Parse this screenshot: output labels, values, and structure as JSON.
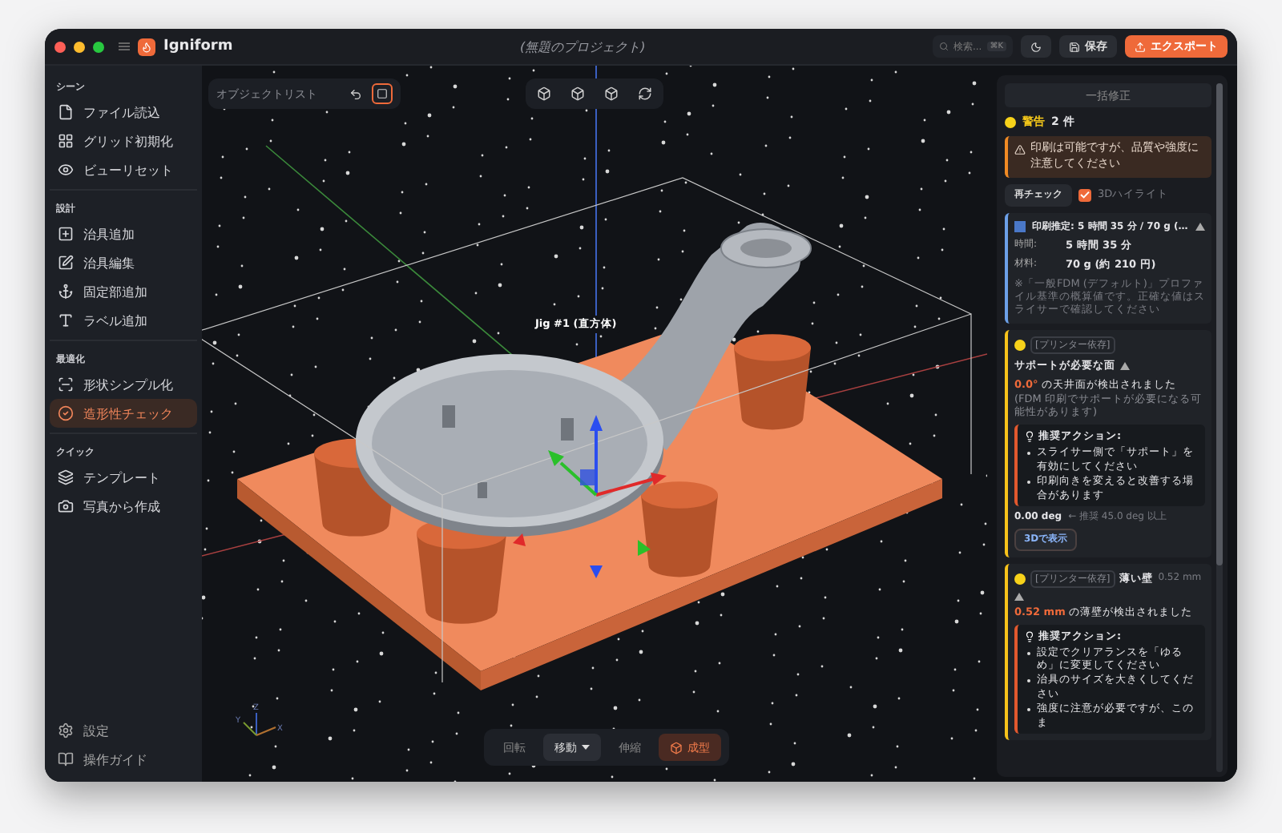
{
  "window": {
    "title": "Igniform",
    "project": "(無題のプロジェクト)"
  },
  "header": {
    "search_placeholder": "検索...",
    "search_shortcut": "⌘K",
    "save": "保存",
    "export": "エクスポート"
  },
  "sidebar": {
    "sections": [
      {
        "title": "シーン",
        "items": [
          {
            "label": "ファイル読込",
            "selected": false
          },
          {
            "label": "グリッド初期化",
            "selected": false
          },
          {
            "label": "ビューリセット",
            "selected": false
          }
        ]
      },
      {
        "title": "設計",
        "items": [
          {
            "label": "治具追加",
            "selected": false
          },
          {
            "label": "治具編集",
            "selected": false
          },
          {
            "label": "固定部追加",
            "selected": false
          },
          {
            "label": "ラベル追加",
            "selected": false
          }
        ]
      },
      {
        "title": "最適化",
        "items": [
          {
            "label": "形状シンプル化",
            "selected": false
          },
          {
            "label": "造形性チェック",
            "selected": true
          }
        ]
      },
      {
        "title": "クイック",
        "items": [
          {
            "label": "テンプレート",
            "selected": false
          },
          {
            "label": "写真から作成",
            "selected": false
          }
        ]
      }
    ],
    "footer": [
      {
        "label": "設定"
      },
      {
        "label": "操作ガイド"
      }
    ]
  },
  "object_list": {
    "title": "オブジェクトリスト",
    "box_mode": true
  },
  "viewport": {
    "object_label": "Jig #1 (直方体)",
    "axis_labels": [
      "X",
      "Y",
      "Z"
    ]
  },
  "mode_bar": [
    {
      "label": "回転",
      "kind": "mode",
      "selected": false
    },
    {
      "label": "移動",
      "kind": "dropdown",
      "selected": true
    },
    {
      "label": "伸縮",
      "kind": "mode",
      "selected": false
    },
    {
      "label": "成型",
      "kind": "action"
    }
  ],
  "check_panel": {
    "fix_all": "一括修正",
    "summary_label": "警告",
    "summary_count": "2 件",
    "alert": "印刷は可能ですが、品質や強度に注意してください",
    "recheck": "再チェック",
    "highlight": {
      "label": "3Dハイライト",
      "checked": true
    },
    "estimate": {
      "title": "印刷推定: 5 時間 35 分 / 70 g (…",
      "expanded": true,
      "rows": [
        {
          "label": "時間:",
          "value": "5 時間 35 分"
        },
        {
          "label": "材料:",
          "value": "70 g (約 210 円)"
        }
      ],
      "note": "※「一般FDM (デフォルト)」プロファイル基準の概算値です。正確な値はスライサーで確認してください"
    },
    "issues": [
      {
        "tag": "[プリンター依存]",
        "title": "サポートが必要な面",
        "expanded": true,
        "value": "0.0°",
        "message": " の天井面が検出されました",
        "note": " (FDM 印刷でサポートが必要になる可能性があります)",
        "action_title": "推奨アクション:",
        "actions": [
          "スライサー側で「サポート」を有効にしてください",
          "印刷向きを変えると改善する場合があります"
        ],
        "reading": "0.00 deg",
        "reading_note": "← 推奨 45.0 deg 以上",
        "view_button": "3Dで表示"
      },
      {
        "tag": "[プリンター依存]",
        "title": "薄い壁",
        "detail": "0.52 mm",
        "expanded": true,
        "value": "0.52 mm",
        "message": " の薄壁が検出されました",
        "action_title": "推奨アクション:",
        "actions": [
          "設定でクリアランスを「ゆるめ」に変更してください",
          "治具のサイズを大きくしてください",
          "強度に注意が必要ですが、このま"
        ]
      }
    ]
  }
}
